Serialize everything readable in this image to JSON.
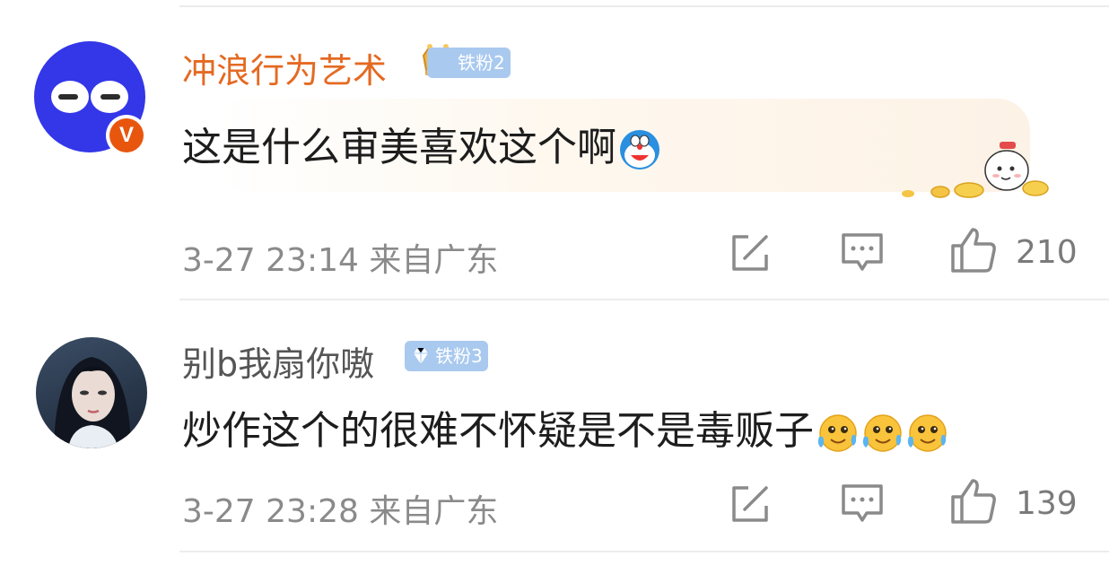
{
  "comments": [
    {
      "username": "冲浪行为艺术",
      "username_color": "#e46a22",
      "fan_badge": "铁粉2",
      "verified_badge": "V",
      "text": "这是什么审美喜欢这个啊",
      "emojis": [
        "doraemon-emoji"
      ],
      "meta": "3-27 23:14 来自广东",
      "like_count": "210"
    },
    {
      "username": "别b我扇你嗷",
      "username_color": "#555555",
      "fan_badge": "铁粉3",
      "text": "炒作这个的很难不怀疑是不是毒贩子",
      "emojis": [
        "crying-laughing-emoji",
        "crying-laughing-emoji",
        "crying-laughing-emoji"
      ],
      "meta": "3-27 23:28 来自广东",
      "like_count": "139"
    }
  ],
  "icons": {
    "share": "share-icon",
    "comment": "comment-icon",
    "like": "thumbs-up-icon"
  },
  "colors": {
    "divider": "#ececec",
    "meta_text": "#8a8a8a",
    "badge_bg": "#a9c9ef"
  }
}
